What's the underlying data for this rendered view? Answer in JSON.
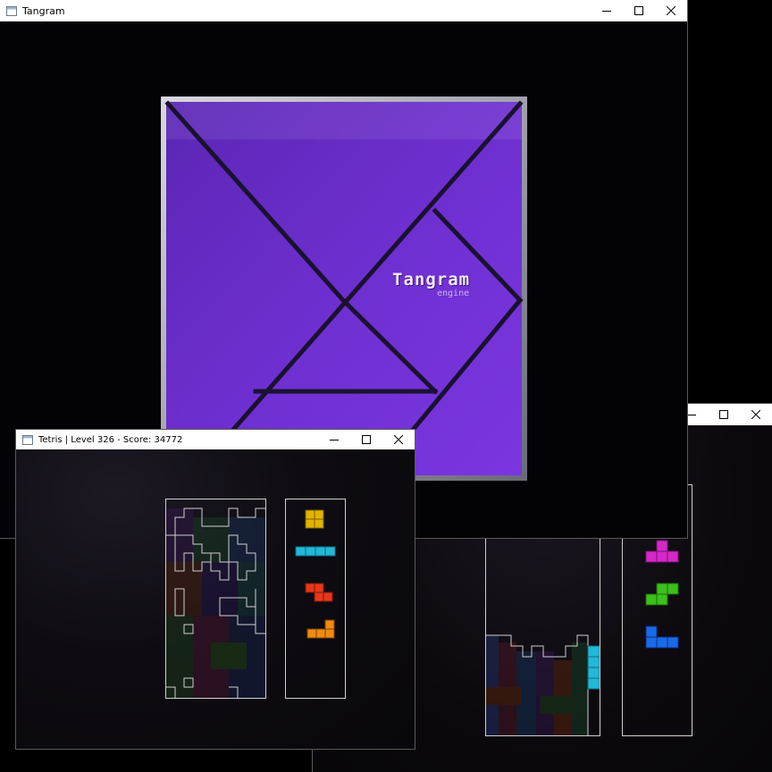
{
  "colors": {
    "purple": "#6a2fc8",
    "purple_light": "#8a3ce4",
    "dark_line": "#1a1230",
    "yellow": "#e0b400",
    "cyan": "#22b8d8",
    "red": "#e8361a",
    "orange": "#f08a10",
    "magenta": "#d428c8",
    "green": "#3cc01a",
    "blue": "#1a6ae8"
  },
  "tangram_window": {
    "title": "Tangram",
    "logo": {
      "title": "Tangram",
      "subtitle": "engine"
    }
  },
  "tetris_window": {
    "title": "Tetris | Level 326 - Score: 34772",
    "next_pieces": [
      "O-piece",
      "I-piece",
      "Z-piece",
      "L-piece"
    ]
  },
  "second_tetris_window": {
    "title": "",
    "next_pieces": [
      "T-piece",
      "S-piece",
      "J-piece"
    ]
  },
  "window_controls": {
    "minimize": "minimize-icon",
    "maximize": "maximize-icon",
    "close": "close-icon"
  }
}
